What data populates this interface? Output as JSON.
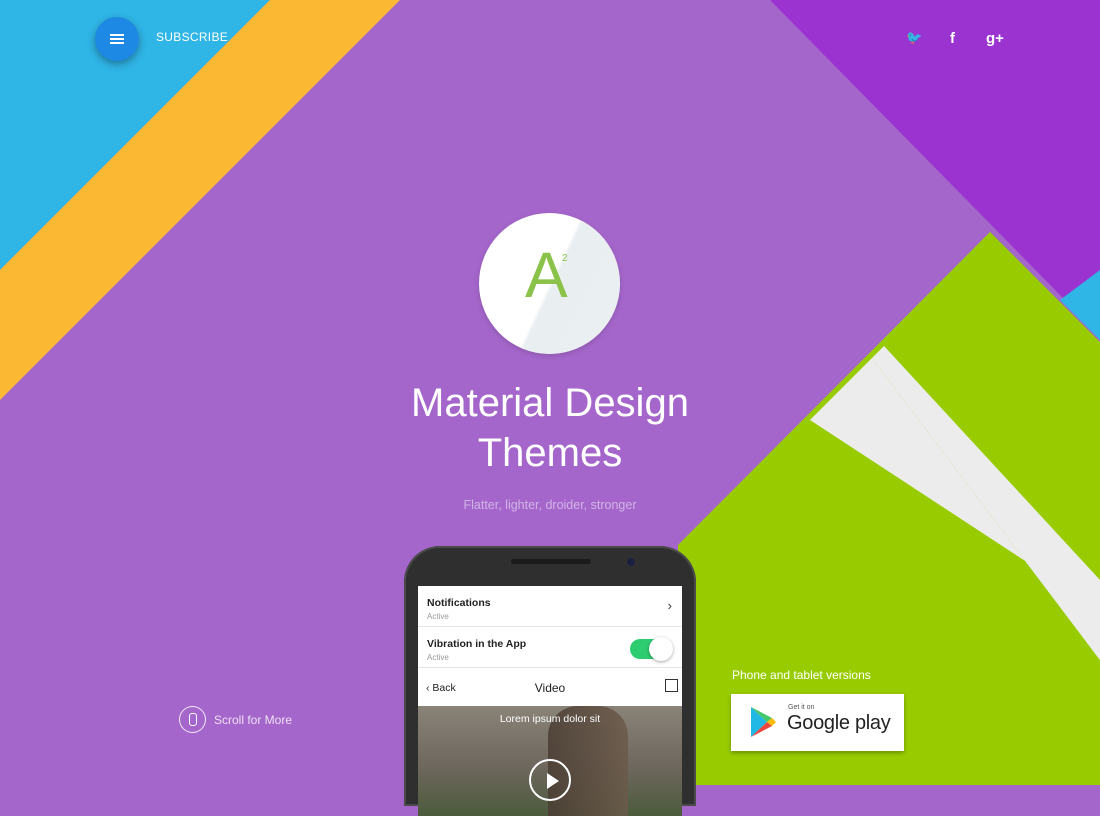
{
  "header": {
    "subscribe_label": "SUBSCRIBE",
    "social": {
      "twitter": "🐦",
      "facebook": "f",
      "google_plus": "g+"
    }
  },
  "logo": {
    "letter": "A",
    "superscript": "2"
  },
  "hero": {
    "title_line1": "Material Design",
    "title_line2": "Themes",
    "tagline": "Flatter, lighter, droider, stronger"
  },
  "scroll": {
    "label": "Scroll for More"
  },
  "phone": {
    "rows": [
      {
        "title": "Notifications",
        "status": "Active"
      },
      {
        "title": "Vibration in the App",
        "status": "Active"
      }
    ],
    "nav": {
      "back_label": "Back",
      "title": "Video"
    },
    "video": {
      "caption": "Lorem ipsum dolor sit"
    }
  },
  "store": {
    "versions_label": "Phone and tablet versions",
    "get_it_on": "Get it on",
    "store_name": "Google play"
  },
  "colors": {
    "background": "#a566cb",
    "blue": "#2fb5e6",
    "yellow": "#fbb933",
    "purple_dark": "#9a33cf",
    "green": "#98cc00",
    "white_stripe": "#ececec",
    "menu_button": "#1e88e5"
  }
}
